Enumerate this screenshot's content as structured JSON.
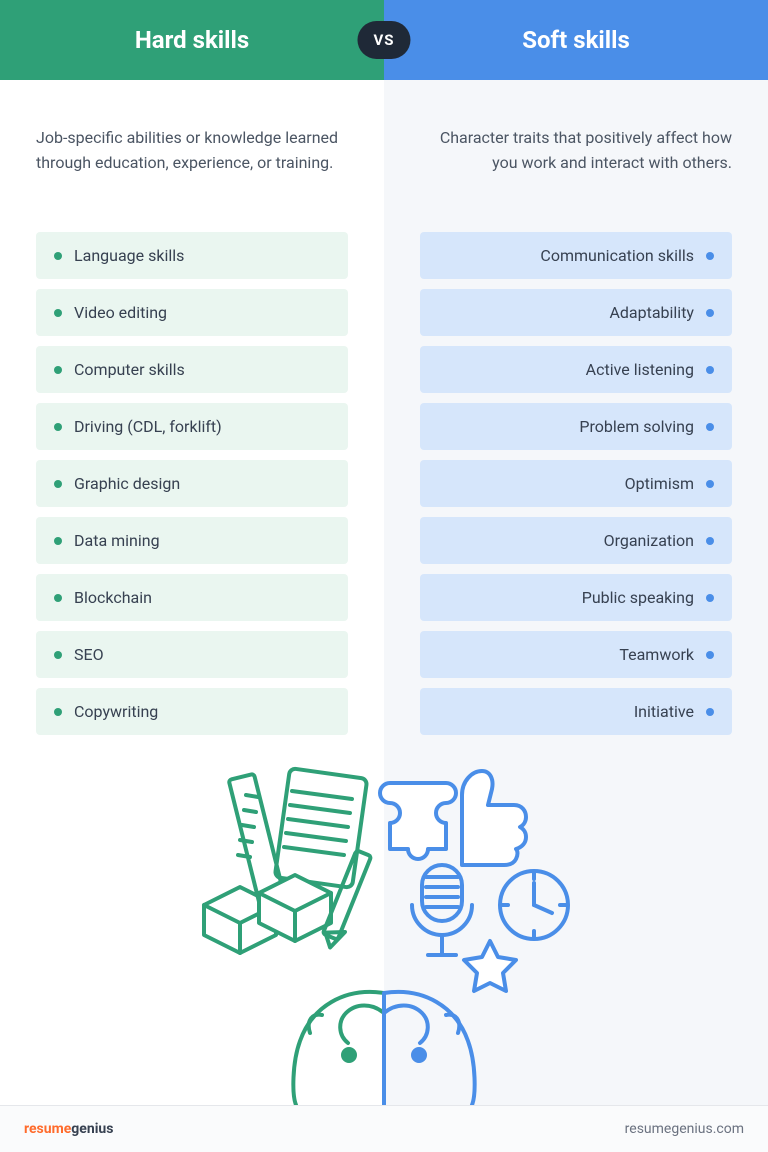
{
  "header": {
    "left_title": "Hard skills",
    "right_title": "Soft skills",
    "vs_label": "VS"
  },
  "hard": {
    "description": "Job-specific abilities or knowledge learned through education, experience, or training.",
    "items": [
      "Language skills",
      "Video editing",
      "Computer skills",
      "Driving (CDL, forklift)",
      "Graphic design",
      "Data mining",
      "Blockchain",
      "SEO",
      "Copywriting"
    ]
  },
  "soft": {
    "description": "Character traits that positively affect how you work and interact with others.",
    "items": [
      "Communication skills",
      "Adaptability",
      "Active listening",
      "Problem solving",
      "Optimism",
      "Organization",
      "Public speaking",
      "Teamwork",
      "Initiative"
    ]
  },
  "footer": {
    "brand_a": "resume",
    "brand_b": "genius",
    "url": "resumegenius.com"
  },
  "colors": {
    "green": "#2fa077",
    "blue": "#4a8ee8"
  }
}
